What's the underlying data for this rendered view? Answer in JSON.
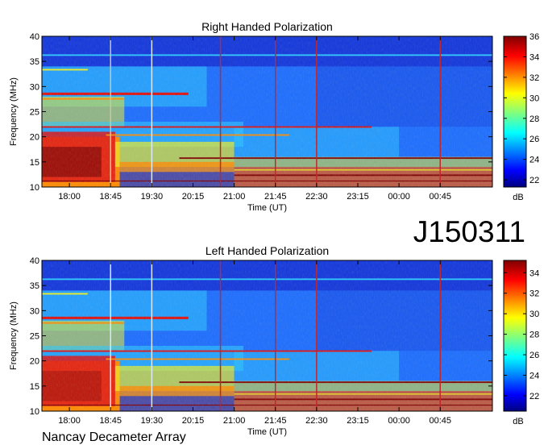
{
  "figure": {
    "event_id": "J150311",
    "footer": "Nancay Decameter Array"
  },
  "chart_data": [
    {
      "type": "heatmap",
      "title": "Right Handed Polarization",
      "xlabel": "Time (UT)",
      "ylabel": "Frequency (MHz)",
      "x_ticks": [
        "18:00",
        "18:45",
        "19:30",
        "20:15",
        "21:00",
        "21:45",
        "22:30",
        "23:15",
        "00:00",
        "00:45"
      ],
      "y_range": [
        10,
        40
      ],
      "y_ticks": [
        10,
        15,
        20,
        25,
        30,
        35,
        40
      ],
      "colorbar": {
        "label": "dB",
        "range": [
          21.3,
          36
        ],
        "ticks": [
          22,
          24,
          26,
          28,
          30,
          32,
          34,
          36
        ]
      },
      "vertical_markers": [
        {
          "time": "18:45",
          "color": "#c8c8a0"
        },
        {
          "time": "19:30",
          "color": "#d8e8f8"
        },
        {
          "time": "20:45",
          "color": "#c0282a"
        },
        {
          "time": "21:45",
          "color": "#c0282a"
        },
        {
          "time": "22:30",
          "color": "#c0282a"
        },
        {
          "time": "00:45",
          "color": "#c0282a"
        }
      ],
      "colormap": "jet"
    },
    {
      "type": "heatmap",
      "title": "Left Handed Polarization",
      "xlabel": "Time (UT)",
      "ylabel": "Frequency (MHz)",
      "x_ticks": [
        "18:00",
        "18:45",
        "19:30",
        "20:15",
        "21:00",
        "21:45",
        "22:30",
        "23:15",
        "00:00",
        "00:45"
      ],
      "y_range": [
        10,
        40
      ],
      "y_ticks": [
        10,
        15,
        20,
        25,
        30,
        35,
        40
      ],
      "colorbar": {
        "label": "dB",
        "range": [
          20.5,
          35.2
        ],
        "ticks": [
          22,
          24,
          26,
          28,
          30,
          32,
          34
        ]
      },
      "vertical_markers": [
        {
          "time": "18:45",
          "color": "#d8e8f8"
        },
        {
          "time": "19:30",
          "color": "#d8e8f8"
        },
        {
          "time": "20:45",
          "color": "#c0282a"
        },
        {
          "time": "21:45",
          "color": "#c0282a"
        },
        {
          "time": "22:30",
          "color": "#c0282a"
        },
        {
          "time": "00:45",
          "color": "#c0282a"
        }
      ],
      "colormap": "jet"
    }
  ]
}
